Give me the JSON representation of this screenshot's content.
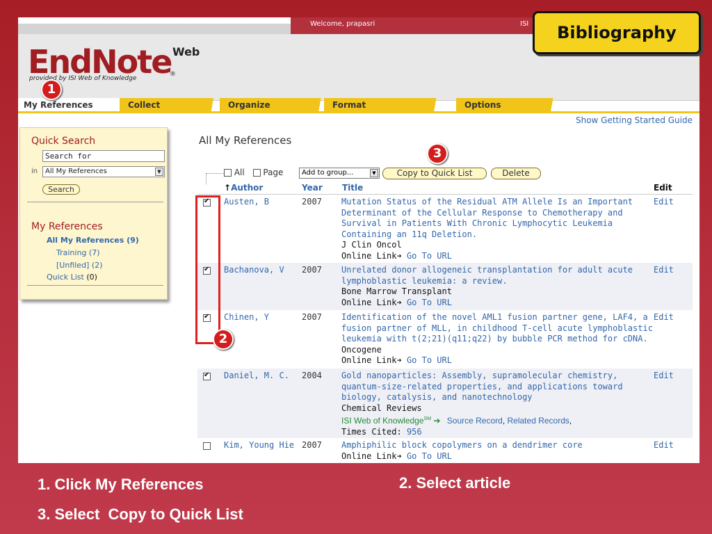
{
  "slide": {
    "badge_title": "Bibliography",
    "captions": [
      "1. Click My References",
      "2. Select article",
      "3. Select  Copy to Quick List"
    ],
    "step_badges": [
      "1",
      "2",
      "3"
    ],
    "highlight_color": "#e01e1e",
    "badge_color": "#d41c1c",
    "slide_bg_color": "#b52d3a"
  },
  "header": {
    "welcome": "Welcome, prapasri",
    "isi": "ISI",
    "logo": "EndNote",
    "logo_web": "Web",
    "logo_reg": "®",
    "logo_sub": "provided by ISI Web of Knowledge"
  },
  "tabs": [
    {
      "label": "My References",
      "active": true
    },
    {
      "label": "Collect"
    },
    {
      "label": "Organize"
    },
    {
      "label": "Format"
    },
    {
      "label": "Options"
    }
  ],
  "guide_link": "Show Getting Started Guide",
  "sidebar": {
    "quick_search_title": "Quick Search",
    "search_value": "Search for",
    "in_label": "in",
    "scope_value": "All My References",
    "search_button": "Search",
    "my_references_title": "My References",
    "items": [
      {
        "label": "All My References (9)"
      },
      {
        "label": "Training (7)"
      },
      {
        "label": "[Unfiled] (2)"
      },
      {
        "label": "Quick List",
        "count": "(0)"
      }
    ]
  },
  "main": {
    "title": "All My References",
    "toolbar": {
      "all_label": "All",
      "page_label": "Page",
      "add_group": "Add to group...",
      "copy_button": "Copy to Quick List",
      "delete_button": "Delete"
    },
    "columns": {
      "sort_arrow": "↑",
      "author": "Author",
      "year": "Year",
      "title": "Title",
      "edit": "Edit"
    },
    "rows": [
      {
        "checked": true,
        "author": "Austen, B",
        "year": "2007",
        "title": "Mutation Status of the Residual ATM Allele Is an Important Determinant of the Cellular Response to Chemotherapy and Survival in Patients With Chronic Lymphocytic Leukemia Containing an 11q Deletion.",
        "journal": "J Clin Oncol",
        "online_link": "Online Link",
        "go_url": "Go To URL",
        "edit": "Edit"
      },
      {
        "checked": true,
        "author": "Bachanova, V",
        "year": "2007",
        "title": "Unrelated donor allogeneic transplantation for adult acute lymphoblastic leukemia: a review.",
        "journal": "Bone Marrow Transplant",
        "online_link": "Online Link",
        "go_url": "Go To URL",
        "edit": "Edit"
      },
      {
        "checked": true,
        "author": "Chinen, Y",
        "year": "2007",
        "title": "Identification of the novel AML1 fusion partner gene, LAF4, a fusion partner of MLL, in childhood T-cell acute lymphoblastic leukemia with t(2;21)(q11;q22) by bubble PCR method for cDNA.",
        "journal": "Oncogene",
        "online_link": "Online Link",
        "go_url": "Go To URL",
        "edit": "Edit"
      },
      {
        "checked": true,
        "author": "Daniel, M. C.",
        "year": "2004",
        "title": "Gold nanoparticles: Assembly, supramolecular chemistry, quantum-size-related properties, and applications toward biology, catalysis, and nanotechnology",
        "journal": "Chemical Reviews",
        "isi_wok": "ISI Web of Knowledge",
        "isi_sm": "SM",
        "source_record": "Source Record",
        "related_records": "Related Records",
        "times_cited_label": "Times Cited:",
        "times_cited": "956",
        "edit": "Edit"
      },
      {
        "checked": false,
        "author": "Kim, Young Hie",
        "year": "2007",
        "title": "Amphiphilic block copolymers on a dendrimer core",
        "online_link": "Online Link",
        "go_url": "Go To URL",
        "edit": "Edit"
      }
    ]
  }
}
